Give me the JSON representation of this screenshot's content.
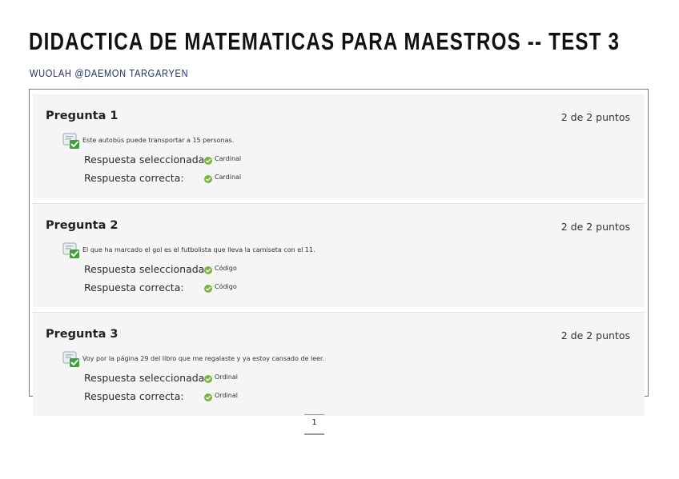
{
  "header": {
    "title": "DIDACTICA DE MATEMATICAS PARA MAESTROS -- TEST 3",
    "subtitle": "WUOLAH @DAEMON TARGARYEN"
  },
  "questions": [
    {
      "title": "Pregunta 1",
      "points": "2 de 2 puntos",
      "text": "Este autobús puede transportar a 15 personas.",
      "selected_label": "Respuesta seleccionada:",
      "selected_value": "Cardinal",
      "correct_label": "Respuesta correcta:",
      "correct_value": "Cardinal"
    },
    {
      "title": "Pregunta 2",
      "points": "2 de 2 puntos",
      "text": "El que ha marcado el gol es el futbolista que lleva la camiseta con el 11.",
      "selected_label": "Respuesta seleccionada:",
      "selected_value": "Código",
      "correct_label": "Respuesta correcta:",
      "correct_value": "Código"
    },
    {
      "title": "Pregunta 3",
      "points": "2 de 2 puntos",
      "text": "Voy por la página 29 del libro que me regalaste y ya estoy cansado de leer.",
      "selected_label": "Respuesta seleccionada:",
      "selected_value": "Ordinal",
      "correct_label": "Respuesta correcta:",
      "correct_value": "Ordinal"
    }
  ],
  "pagination": {
    "current_page": "1"
  },
  "colors": {
    "check_green": "#7ab53a",
    "subtitle_blue": "#1c2e7a",
    "border_grey": "#7a7a7a"
  }
}
